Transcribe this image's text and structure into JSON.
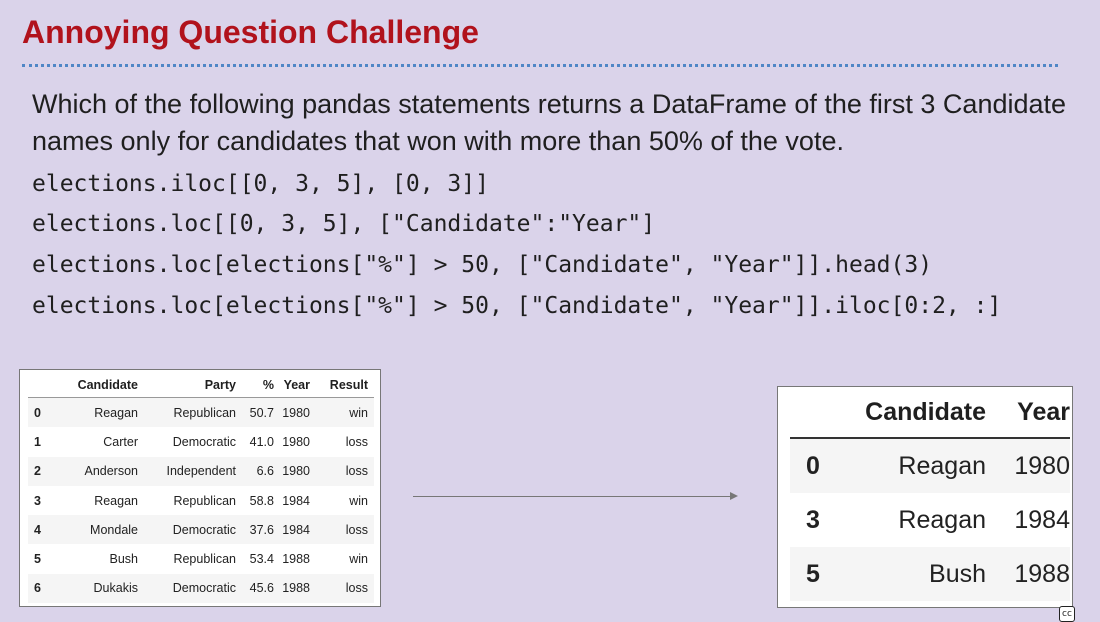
{
  "title": "Annoying Question Challenge",
  "question": "Which of the following pandas statements returns a DataFrame of the first 3 Candidate names only for candidates that won with more than 50% of the vote.",
  "options": [
    "elections.iloc[[0, 3, 5], [0, 3]]",
    "elections.loc[[0, 3, 5], [\"Candidate\":\"Year\"]",
    "elections.loc[elections[\"%\"] > 50, [\"Candidate\", \"Year\"]].head(3)",
    "elections.loc[elections[\"%\"] > 50, [\"Candidate\", \"Year\"]].iloc[0:2, :]"
  ],
  "left_table": {
    "columns": [
      "Candidate",
      "Party",
      "%",
      "Year",
      "Result"
    ],
    "rows": [
      {
        "idx": "0",
        "Candidate": "Reagan",
        "Party": "Republican",
        "pct": "50.7",
        "Year": "1980",
        "Result": "win"
      },
      {
        "idx": "1",
        "Candidate": "Carter",
        "Party": "Democratic",
        "pct": "41.0",
        "Year": "1980",
        "Result": "loss"
      },
      {
        "idx": "2",
        "Candidate": "Anderson",
        "Party": "Independent",
        "pct": "6.6",
        "Year": "1980",
        "Result": "loss"
      },
      {
        "idx": "3",
        "Candidate": "Reagan",
        "Party": "Republican",
        "pct": "58.8",
        "Year": "1984",
        "Result": "win"
      },
      {
        "idx": "4",
        "Candidate": "Mondale",
        "Party": "Democratic",
        "pct": "37.6",
        "Year": "1984",
        "Result": "loss"
      },
      {
        "idx": "5",
        "Candidate": "Bush",
        "Party": "Republican",
        "pct": "53.4",
        "Year": "1988",
        "Result": "win"
      },
      {
        "idx": "6",
        "Candidate": "Dukakis",
        "Party": "Democratic",
        "pct": "45.6",
        "Year": "1988",
        "Result": "loss"
      }
    ]
  },
  "right_table": {
    "columns": [
      "Candidate",
      "Year"
    ],
    "rows": [
      {
        "idx": "0",
        "Candidate": "Reagan",
        "Year": "1980"
      },
      {
        "idx": "3",
        "Candidate": "Reagan",
        "Year": "1984"
      },
      {
        "idx": "5",
        "Candidate": "Bush",
        "Year": "1988"
      }
    ]
  },
  "license_badge": "cc",
  "colors": {
    "background": "#dad3ea",
    "title": "#b1121c",
    "divider": "#4f86c6"
  }
}
